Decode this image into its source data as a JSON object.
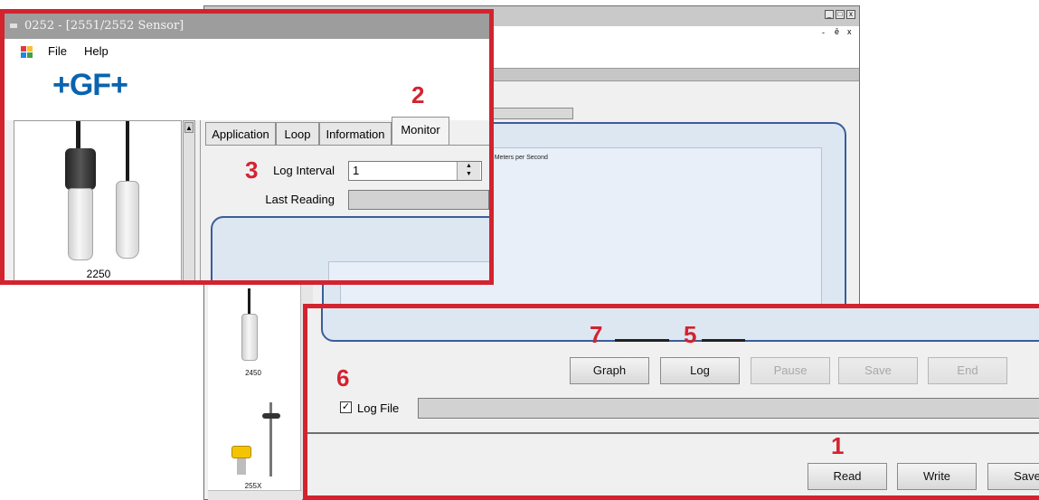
{
  "window": {
    "title": "0252 - [2551/2552 Sensor]",
    "menu": [
      "File",
      "Help"
    ],
    "logo": "+GF+"
  },
  "controls": {
    "minimize": "_",
    "restore": "□",
    "close": "x",
    "min2": "-",
    "rest2": "ē",
    "close2": "x"
  },
  "products": [
    {
      "label": "2250"
    },
    {
      "label": "2450"
    },
    {
      "label": "255X"
    }
  ],
  "tabs": [
    {
      "label": "Application"
    },
    {
      "label": "Loop"
    },
    {
      "label": "Information"
    },
    {
      "label": "Monitor",
      "active": true
    }
  ],
  "monitor": {
    "log_interval_label": "Log Interval",
    "log_interval_value": "1",
    "last_reading_label": "Last Reading",
    "last_reading_value": "",
    "legend": "Flow Meters per Second",
    "legend_color": "#c62828"
  },
  "actions": {
    "graph": "Graph",
    "log": "Log",
    "pause": "Pause",
    "save": "Save",
    "end": "End"
  },
  "log_file": {
    "label": "Log File",
    "checked": true,
    "path": ""
  },
  "footer": {
    "read": "Read",
    "write": "Write",
    "save": "Save"
  },
  "callouts": {
    "n1": "1",
    "n2": "2",
    "n3": "3",
    "n5": "5",
    "n6": "6",
    "n7": "7"
  },
  "colors": {
    "callout_red": "#d3232f",
    "brand_blue": "#0a64ae",
    "chart_border": "#3a5d9a"
  }
}
